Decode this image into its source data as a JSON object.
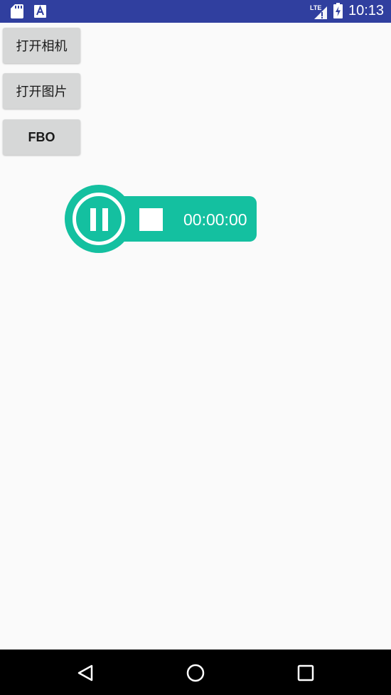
{
  "status_bar": {
    "time": "10:13",
    "network": "LTE",
    "icons": [
      "sd-card-icon",
      "a-notification-icon",
      "lte-signal-icon",
      "battery-charging-icon"
    ]
  },
  "buttons": {
    "open_camera": "打开相机",
    "open_picture": "打开图片",
    "fbo": "FBO"
  },
  "recorder": {
    "timer": "00:00:00",
    "accent_color": "#14c0a0",
    "icons": [
      "pause-icon",
      "stop-icon"
    ]
  },
  "nav_bar": {
    "icons": [
      "back-icon",
      "home-icon",
      "recents-icon"
    ]
  },
  "colors": {
    "status_bar": "#303f9f",
    "background": "#fafafa",
    "button": "#d6d7d7"
  }
}
